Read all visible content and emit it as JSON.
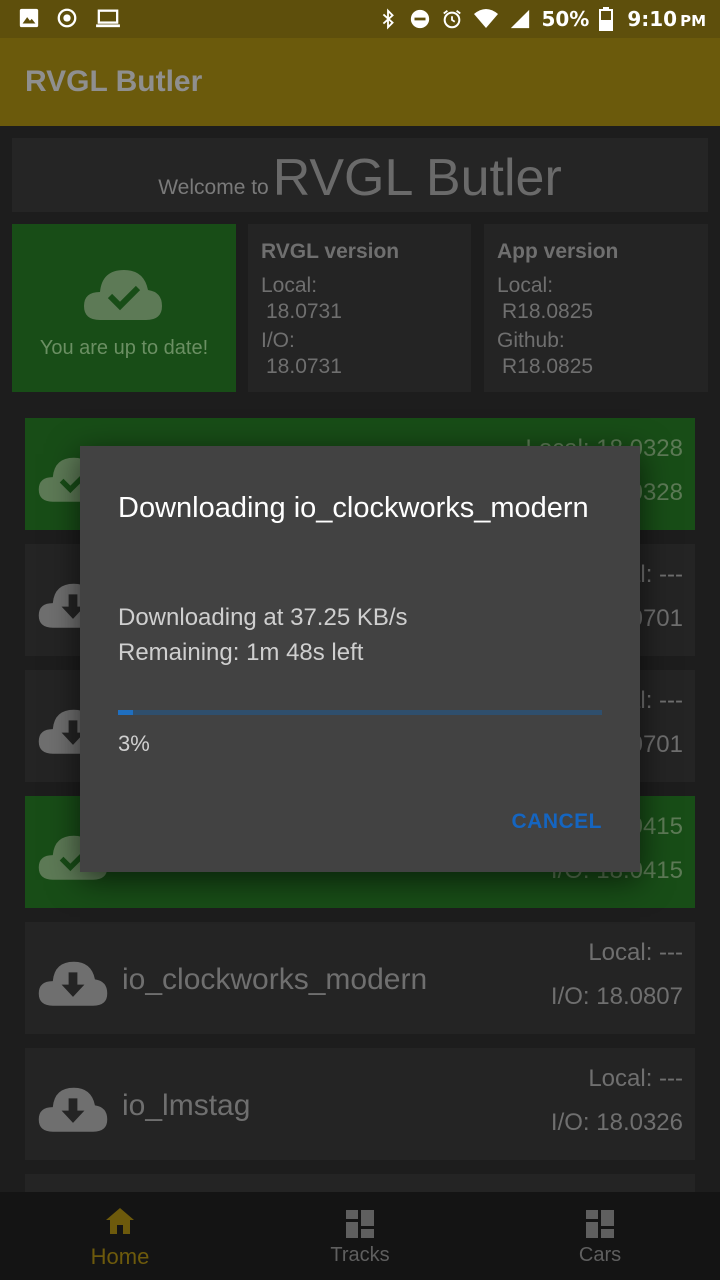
{
  "status_bar": {
    "battery": "50%",
    "time": "9:10",
    "ampm": "PM"
  },
  "app_bar": {
    "title": "RVGL Butler"
  },
  "welcome": {
    "prefix": "Welcome to",
    "name": "RVGL Butler"
  },
  "update_card": {
    "icon": "cloud-check-icon",
    "text": "You are up to date!"
  },
  "rvgl_version": {
    "title": "RVGL version",
    "local_label": "Local:",
    "local_value": "18.0731",
    "io_label": "I/O:",
    "io_value": "18.0731"
  },
  "app_version": {
    "title": "App version",
    "local_label": "Local:",
    "local_value": "R18.0825",
    "github_label": "Github:",
    "github_value": "R18.0825"
  },
  "packages": [
    {
      "name": "",
      "local": "Local: 18.0328",
      "io": "I/O: 18.0328",
      "status": "installed"
    },
    {
      "name": "",
      "local": "Local: ---",
      "io": "I/O: 18.0701",
      "status": "available"
    },
    {
      "name": "",
      "local": "Local: ---",
      "io": "I/O: 18.0701",
      "status": "available"
    },
    {
      "name": "",
      "local": "Local: 18.0415",
      "io": "I/O: 18.0415",
      "status": "installed"
    },
    {
      "name": "io_clockworks_modern",
      "local": "Local: ---",
      "io": "I/O: 18.0807",
      "status": "available"
    },
    {
      "name": "io_lmstag",
      "local": "Local: ---",
      "io": "I/O: 18.0326",
      "status": "available"
    }
  ],
  "dialog": {
    "title": "Downloading io_clockworks_modern",
    "speed": "Downloading at 37.25 KB/s",
    "remaining": "Remaining: 1m 48s left",
    "progress": 0.03,
    "percent": "3%",
    "cancel_label": "CANCEL"
  },
  "bottom_nav": {
    "items": [
      {
        "label": "Home",
        "icon": "home-icon"
      },
      {
        "label": "Tracks",
        "icon": "grid-icon"
      },
      {
        "label": "Cars",
        "icon": "grid-icon"
      }
    ]
  },
  "colors": {
    "accent": "#6d5a0c",
    "installed": "#184d17",
    "progress": "#1f6fc0"
  }
}
